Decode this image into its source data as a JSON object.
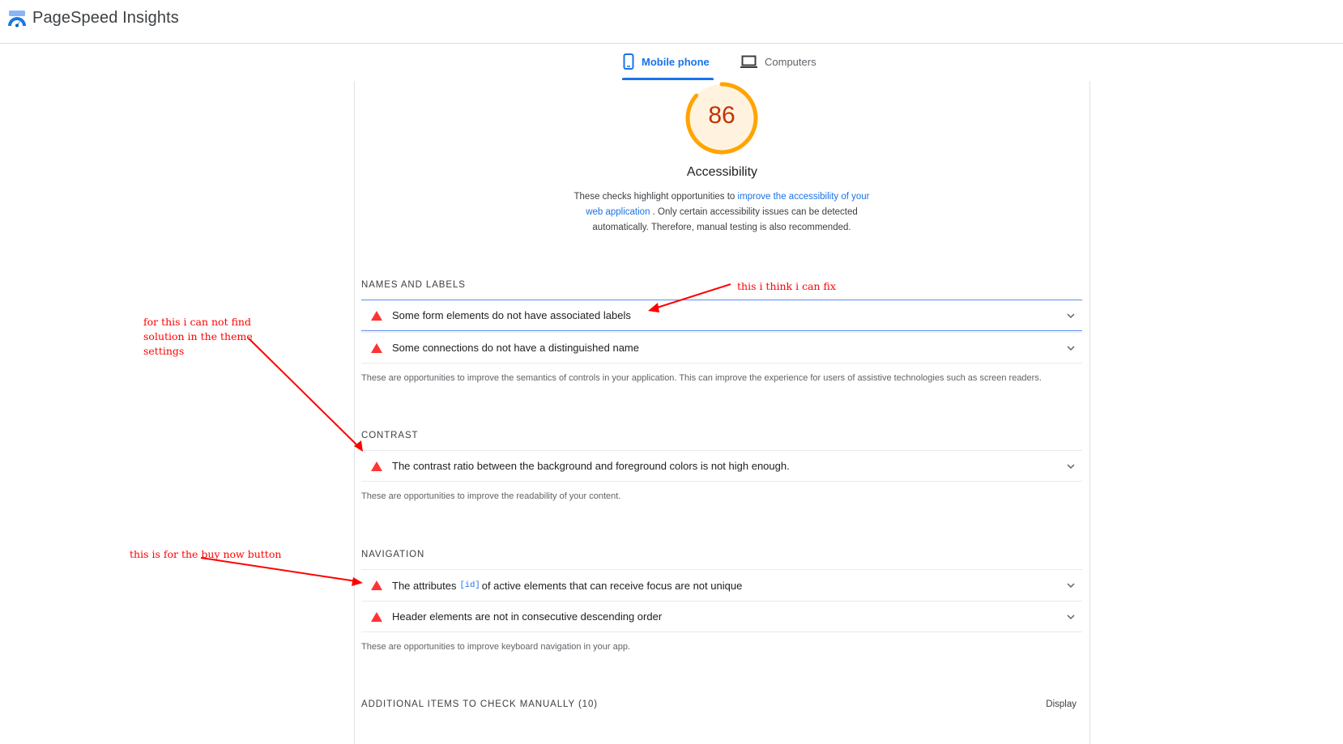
{
  "header": {
    "brand": "PageSpeed Insights"
  },
  "tabs": [
    {
      "label": "Mobile phone",
      "active": true
    },
    {
      "label": "Computers",
      "active": false
    }
  ],
  "category": {
    "score": "86",
    "title": "Accessibility",
    "desc_before": "These checks highlight opportunities to ",
    "desc_link": "improve the accessibility of your web application",
    "desc_after": " . Only certain accessibility issues can be detected automatically. Therefore, manual testing is also recommended."
  },
  "groups": {
    "names": {
      "title": "NAMES AND LABELS",
      "audits": [
        "Some form elements do not have associated labels",
        "Some connections do not have a distinguished name"
      ],
      "desc": "These are opportunities to improve the semantics of controls in your application. This can improve the experience for users of assistive technologies such as screen readers."
    },
    "contrast": {
      "title": "CONTRAST",
      "audits": [
        "The contrast ratio between the background and foreground colors is not high enough."
      ],
      "desc": "These are opportunities to improve the readability of your content."
    },
    "navigation": {
      "title": "NAVIGATION",
      "audit1_before": "The attributes ",
      "audit1_code": "[id]",
      "audit1_after": "of active elements that can receive focus are not unique",
      "audit2": "Header elements are not in consecutive descending order",
      "desc": "These are opportunities to improve keyboard navigation in your app."
    },
    "additional": {
      "title": "ADDITIONAL ITEMS TO CHECK MANUALLY (10)",
      "right": "Display"
    }
  },
  "annotations": {
    "fix": "this i think i can fix",
    "theme_line1": "for this i can not find",
    "theme_line2": "solution in the theme",
    "theme_line3": "settings",
    "buy": "this is for the buy now button"
  },
  "colors": {
    "accent": "#1a73e8",
    "score_text": "#c33300",
    "gauge_ring": "#ffa400",
    "gauge_fill": "#fff3e0",
    "fail": "#ff3333",
    "annotation": "#ff0000"
  },
  "icons": [
    "pagespeed-logo-icon",
    "mobile-phone-icon",
    "laptop-icon",
    "fail-triangle-icon",
    "chevron-down-icon"
  ]
}
